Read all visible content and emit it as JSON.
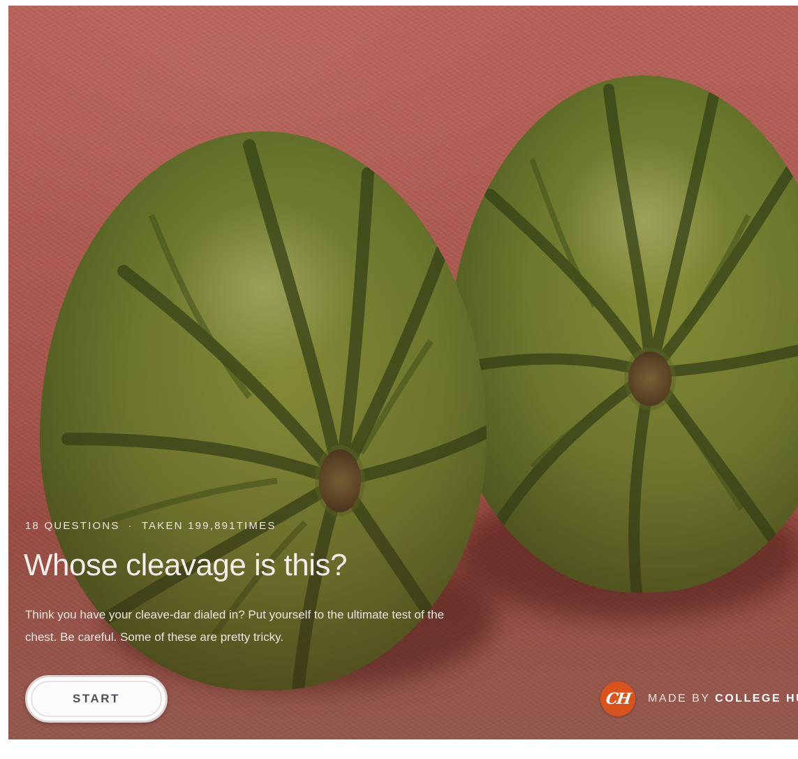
{
  "quiz": {
    "question_count": "18 QUESTIONS",
    "separator": "·",
    "taken_count": "TAKEN 199,891TIMES",
    "title": "Whose cleavage is this?",
    "description": "Think you have your cleave-dar dialed in? Put yourself to the ultimate test of the chest. Be careful. Some of these are pretty tricky.",
    "start_label": "START"
  },
  "brand": {
    "logo_text": "CH",
    "made_by_prefix": "MADE BY ",
    "made_by_name": "COLLEGE HU",
    "logo_color": "#d9531e"
  },
  "hero": {
    "image": "two-watermelons-on-pink-cloth",
    "background_color": "#b35f55"
  }
}
